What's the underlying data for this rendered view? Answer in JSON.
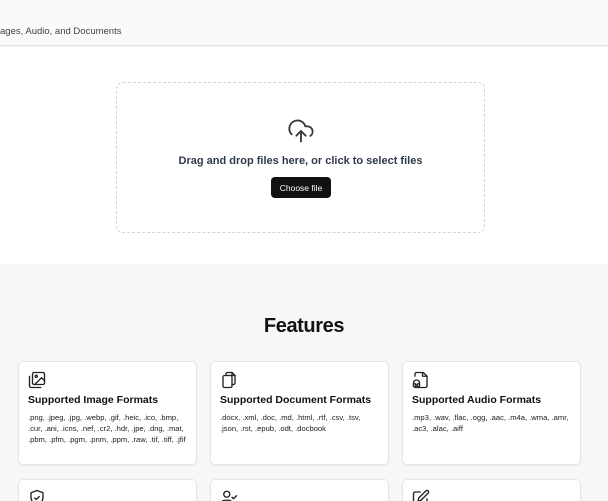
{
  "header": {
    "subtitle": "ages, Audio, and Documents"
  },
  "upload": {
    "icon": "upload-cloud-icon",
    "prompt": "Drag and drop files here, or click to select files",
    "button_label": "Choose file"
  },
  "features": {
    "title": "Features",
    "cards": [
      {
        "icon": "image-stack-icon",
        "title": "Supported Image Formats",
        "description": ".png, .jpeg, .jpg, .webp, .gif, .heic, .ico, .bmp, .cur, .ani, .icns, .nef, .cr2, .hdr, .jpe, .dng, .mat, .pbm, .pfm, .pgm, .pnm, .ppm, .raw, .tif, .tiff, .jfif"
      },
      {
        "icon": "copy-files-icon",
        "title": "Supported Document Formats",
        "description": ".docx, .xml, .doc, .md, .html, .rtf, .csv, .tsv, .json, .rst, .epub, .odt, .docbook"
      },
      {
        "icon": "audio-file-icon",
        "title": "Supported Audio Formats",
        "description": ".mp3, .wav, .flac, .ogg, .aac, .m4a, .wma, .amr, .ac3, .alac, .aiff"
      },
      {
        "icon": "shield-check-icon"
      },
      {
        "icon": "user-check-icon"
      },
      {
        "icon": "edit-pen-icon"
      }
    ]
  }
}
